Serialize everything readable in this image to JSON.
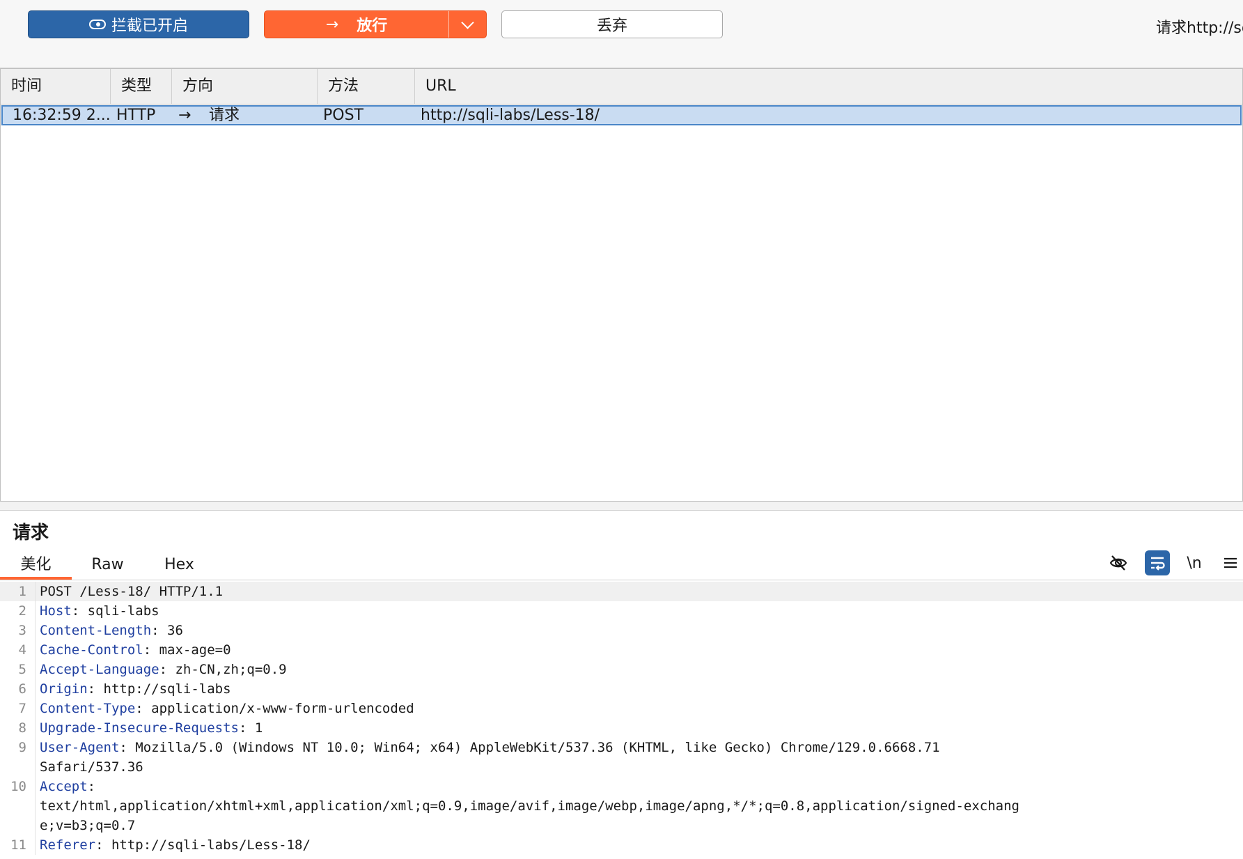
{
  "toolbar": {
    "intercept_label": "拦截已开启",
    "forward_label": "放行",
    "drop_label": "丢弃",
    "request_title": "请求http://sqli-labs"
  },
  "table": {
    "columns": [
      "时间",
      "类型",
      "方向",
      "方法",
      "URL"
    ],
    "rows": [
      {
        "time": "16:32:59 2...",
        "type": "HTTP",
        "direction_arrow": "→",
        "direction": "请求",
        "method": "POST",
        "url": "http://sqli-labs/Less-18/"
      }
    ]
  },
  "pane": {
    "title": "请求",
    "tabs": [
      "美化",
      "Raw",
      "Hex"
    ],
    "newline_label": "\\n"
  },
  "editor": {
    "lines": [
      {
        "num": "1",
        "name": "",
        "value": "POST /Less-18/ HTTP/1.1"
      },
      {
        "num": "2",
        "name": "Host",
        "value": ": sqli-labs"
      },
      {
        "num": "3",
        "name": "Content-Length",
        "value": ": 36"
      },
      {
        "num": "4",
        "name": "Cache-Control",
        "value": ": max-age=0"
      },
      {
        "num": "5",
        "name": "Accept-Language",
        "value": ": zh-CN,zh;q=0.9"
      },
      {
        "num": "6",
        "name": "Origin",
        "value": ": http://sqli-labs"
      },
      {
        "num": "7",
        "name": "Content-Type",
        "value": ": application/x-www-form-urlencoded"
      },
      {
        "num": "8",
        "name": "Upgrade-Insecure-Requests",
        "value": ": 1"
      },
      {
        "num": "9",
        "name": "User-Agent",
        "value": ": Mozilla/5.0 (Windows NT 10.0; Win64; x64) AppleWebKit/537.36 (KHTML, like Gecko) Chrome/129.0.6668.71"
      },
      {
        "num": "",
        "name": "",
        "value": "Safari/537.36"
      },
      {
        "num": "10",
        "name": "Accept",
        "value": ":"
      },
      {
        "num": "",
        "name": "",
        "value": "text/html,application/xhtml+xml,application/xml;q=0.9,image/avif,image/webp,image/apng,*/*;q=0.8,application/signed-exchang"
      },
      {
        "num": "",
        "name": "",
        "value": "e;v=b3;q=0.7"
      },
      {
        "num": "11",
        "name": "Referer",
        "value": ": http://sqli-labs/Less-18/"
      }
    ]
  }
}
